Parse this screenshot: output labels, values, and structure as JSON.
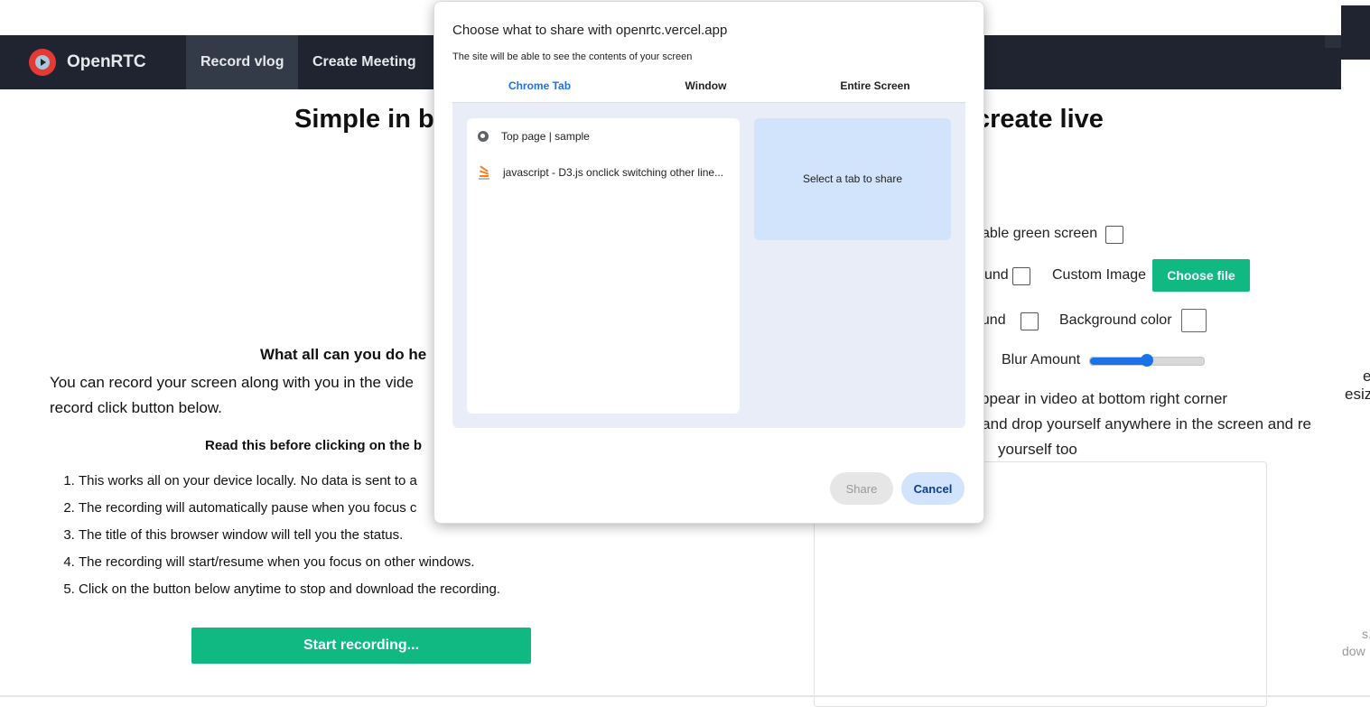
{
  "navbar": {
    "brand": "OpenRTC",
    "items": [
      {
        "label": "Record vlog",
        "active": true
      },
      {
        "label": "Create Meeting",
        "active": false
      }
    ],
    "bg_color": "#1f2430"
  },
  "headline": {
    "left": "Simple in b",
    "right": "create live"
  },
  "left": {
    "what_title": "What all can you do he",
    "description": "You can record your screen along with you in the vide record click button below.",
    "read_title": "Read this before clicking on the b",
    "rules": [
      "This works all on your device locally. No data is sent to a",
      "The recording will automatically pause when you focus c",
      "The title of this browser window will tell you the status.",
      "The recording will start/resume when you focus on other windows.",
      "Click on the button below anytime to stop and download the recording."
    ],
    "start_button": "Start recording..."
  },
  "right": {
    "green_screen_label": "able green screen",
    "bg_label_1": "und",
    "custom_image_label": "Custom Image",
    "choose_file": "Choose file",
    "bg_label_2": "ound",
    "background_color_label": "Background color",
    "blur_label": "Blur Amount",
    "blur_value": 0.5,
    "note_line1": "ppear in video at bottom right corner",
    "note_line2": "g and drop yourself anywhere in the screen and re",
    "note_line3": "yourself too",
    "accent_color": "#10b981"
  },
  "edge": {
    "t1": "e",
    "t2": "esiz",
    "t3": "s.",
    "t4": "dow"
  },
  "dialog": {
    "title": "Choose what to share with openrtc.vercel.app",
    "subtitle": "The site will be able to see the contents of your screen",
    "tabs": [
      {
        "label": "Chrome Tab",
        "active": true
      },
      {
        "label": "Window",
        "active": false
      },
      {
        "label": "Entire Screen",
        "active": false
      }
    ],
    "items": [
      {
        "label": "Top page | sample",
        "icon": "globe-icon"
      },
      {
        "label": "javascript - D3.js onclick switching other line...",
        "icon": "stackoverflow-icon"
      }
    ],
    "preview_text": "Select a tab to share",
    "share_button": "Share",
    "cancel_button": "Cancel"
  }
}
